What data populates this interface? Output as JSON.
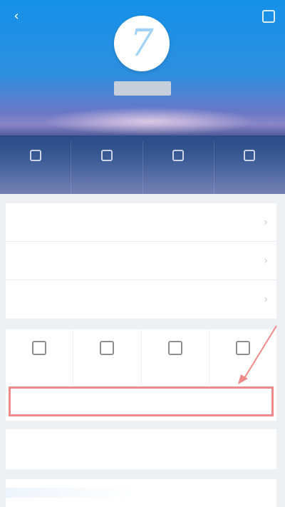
{
  "header": {
    "back_icon": "back-arrow-icon",
    "settings_icon": "settings-icon",
    "username": "",
    "signature": "",
    "stats": [
      {
        "label": "",
        "icon": "document-icon"
      },
      {
        "label": "",
        "icon": "calendar-icon"
      },
      {
        "label": "",
        "icon": "user-icon"
      },
      {
        "label": "",
        "icon": "grid-icon"
      }
    ]
  },
  "menu": {
    "items": [
      {
        "label": ""
      },
      {
        "label": ""
      },
      {
        "label": ""
      }
    ]
  },
  "quick_grid": {
    "items": [
      {
        "label": "",
        "icon": "document-icon"
      },
      {
        "label": "",
        "icon": "user-icon"
      },
      {
        "label": "",
        "icon": "message-icon"
      },
      {
        "label": "",
        "icon": "edit-icon"
      }
    ]
  },
  "tag_row": {
    "label": "",
    "tags": [
      "",
      "",
      ""
    ]
  },
  "notice": {
    "title": "",
    "subtitle": ""
  },
  "colors": {
    "header_blue": "#1591e8",
    "annotation_red": "#f08a8a",
    "notice_red": "#e0413a"
  }
}
